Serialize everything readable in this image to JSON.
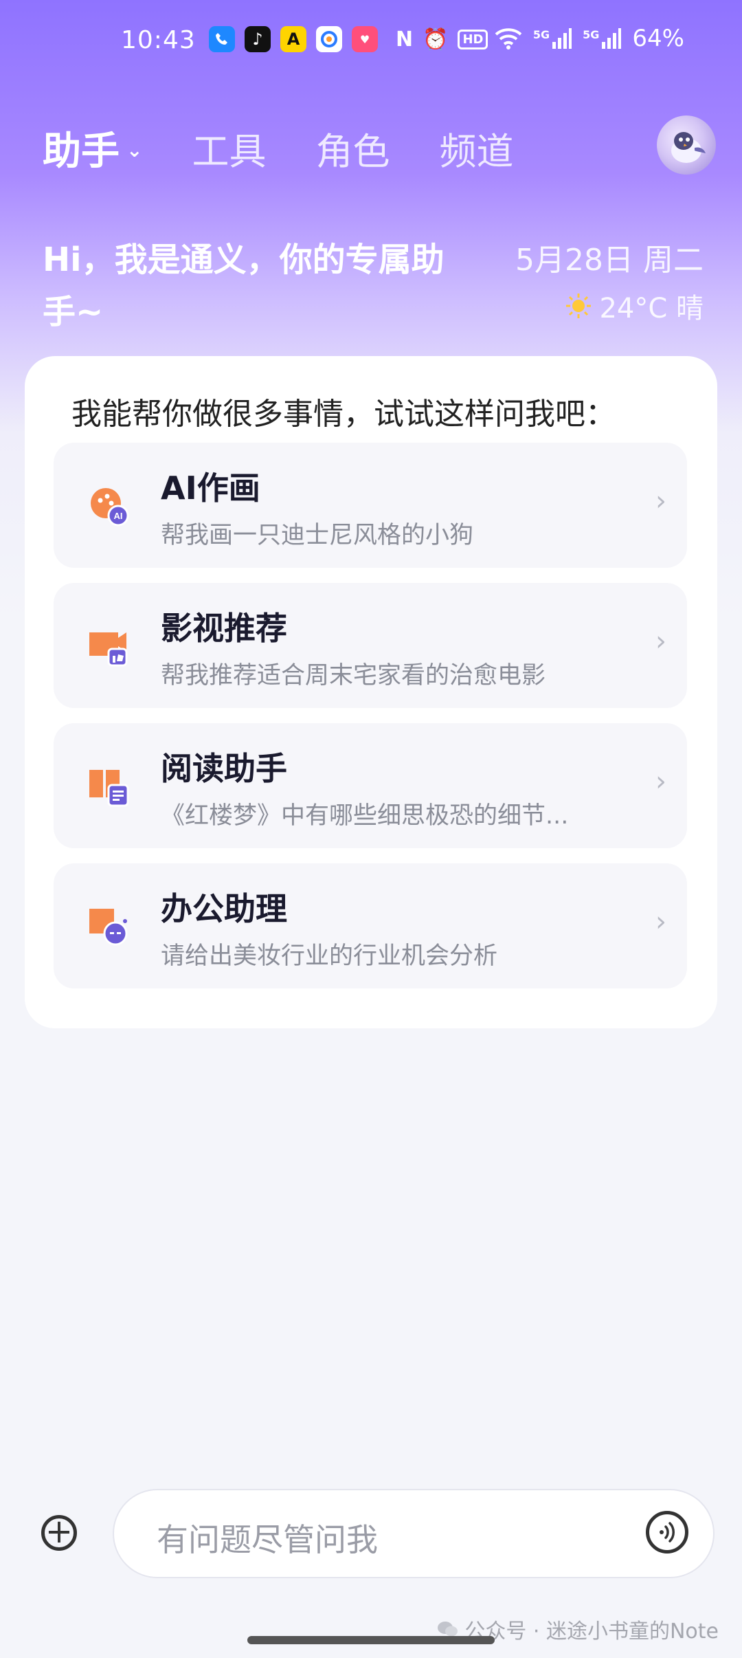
{
  "status_bar": {
    "time": "10:43",
    "network_1": "5G",
    "network_2": "5G",
    "battery": "64%",
    "hd_label": "HD"
  },
  "nav": {
    "active_tab": "助手",
    "tabs": [
      "工具",
      "角色",
      "频道"
    ]
  },
  "greeting": {
    "line1": "Hi，我是通义，你的专属助",
    "line2": "手~"
  },
  "date": "5月28日 周二",
  "weather": {
    "text": "24°C 晴",
    "icon": "sun-icon"
  },
  "card": {
    "title": "我能帮你做很多事情，试试这样问我吧：",
    "items": [
      {
        "title": "AI作画",
        "subtitle": "帮我画一只迪士尼风格的小狗",
        "icon": "ai-paint-icon",
        "badge": "AI"
      },
      {
        "title": "影视推荐",
        "subtitle": "帮我推荐适合周末宅家看的治愈电影",
        "icon": "movie-recommend-icon"
      },
      {
        "title": "阅读助手",
        "subtitle": "《红楼梦》中有哪些细思极恐的细节...",
        "icon": "reading-assistant-icon"
      },
      {
        "title": "办公助理",
        "subtitle": "请给出美妆行业的行业机会分析",
        "icon": "office-assistant-icon"
      }
    ]
  },
  "input": {
    "placeholder": "有问题尽管问我"
  },
  "watermark": "公众号 · 迷途小书童的Note",
  "colors": {
    "accent_purple": "#8f73ff",
    "icon_orange": "#f5894b",
    "icon_purple": "#6b5bd6"
  }
}
